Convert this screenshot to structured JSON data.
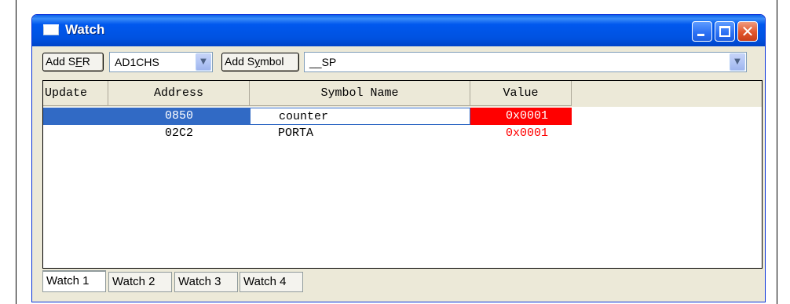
{
  "window": {
    "title": "Watch"
  },
  "toolbar": {
    "add_sfr_pre": "Add S",
    "add_sfr_key": "F",
    "add_sfr_post": "R",
    "sfr_value": "AD1CHS",
    "add_symbol_pre": "Add S",
    "add_symbol_key": "y",
    "add_symbol_post": "mbol",
    "symbol_value": "__SP"
  },
  "grid": {
    "columns": [
      "Update",
      "Address",
      "Symbol Name",
      "Value"
    ],
    "rows": [
      {
        "update": "",
        "address": "0850",
        "symbol": "counter",
        "value": "0x0001"
      },
      {
        "update": "",
        "address": "02C2",
        "symbol": "PORTA",
        "value": "0x0001"
      }
    ]
  },
  "tabs": [
    "Watch 1",
    "Watch 2",
    "Watch 3",
    "Watch 4"
  ],
  "colors": {
    "title_bar": "#0058ee",
    "selection": "#316ac5",
    "changed_value": "#ff0000"
  }
}
